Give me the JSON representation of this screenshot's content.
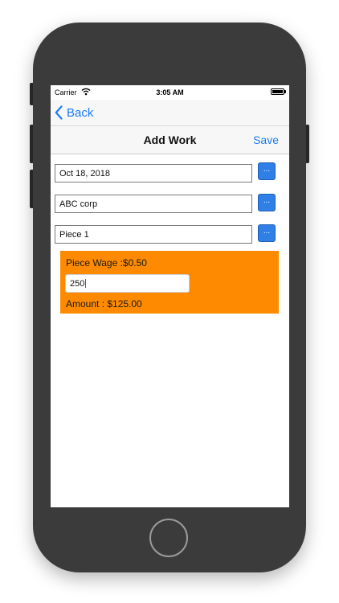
{
  "status_bar": {
    "carrier": "Carrier",
    "time": "3:05 AM"
  },
  "nav": {
    "back_label": "Back",
    "title": "Add Work",
    "save_label": "Save"
  },
  "form": {
    "date_value": "Oct 18, 2018",
    "company_value": "ABC corp",
    "piece_value": "Piece 1",
    "picker_label": "..."
  },
  "wage_panel": {
    "piece_wage": "Piece Wage :$0.50",
    "quantity_value": "250",
    "amount": "Amount : $125.00"
  },
  "colors": {
    "accent": "#1a7cf5",
    "picker_button": "#2f7fe6",
    "wage_panel": "#fd8a00",
    "phone_body": "#3b3b3b"
  },
  "icons": [
    "wifi-icon",
    "battery-icon",
    "chevron-left-icon",
    "home-button"
  ]
}
